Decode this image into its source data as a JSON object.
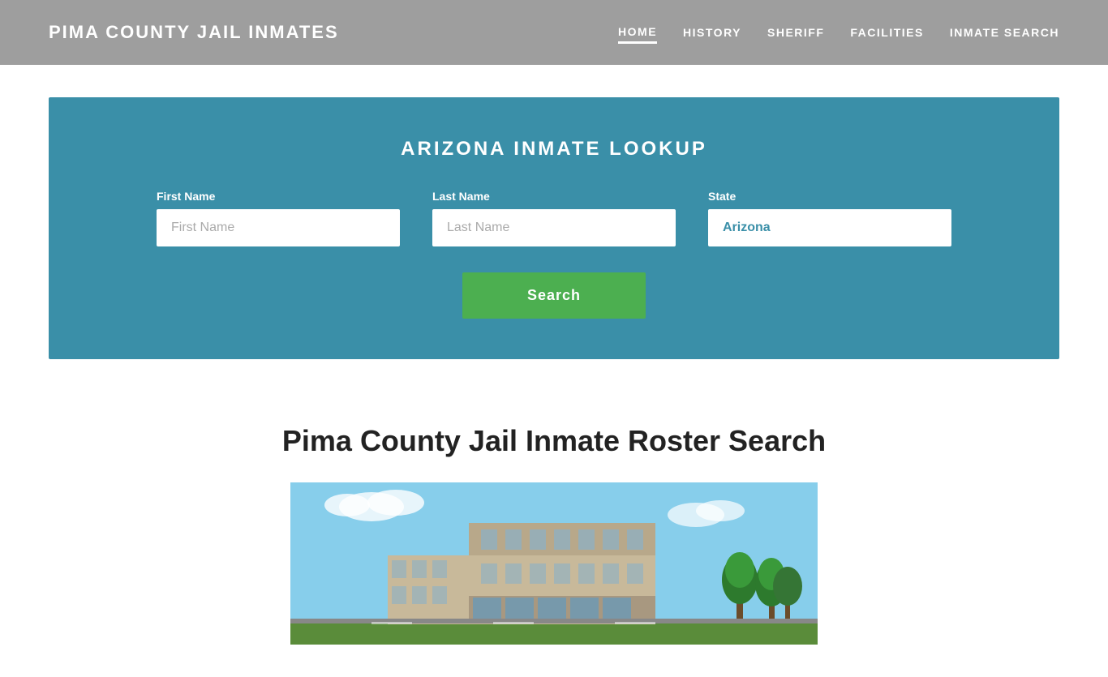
{
  "header": {
    "site_title": "PIMA COUNTY JAIL INMATES",
    "nav_items": [
      {
        "label": "HOME",
        "active": true
      },
      {
        "label": "HISTORY",
        "active": false
      },
      {
        "label": "SHERIFF",
        "active": false
      },
      {
        "label": "FACILITIES",
        "active": false
      },
      {
        "label": "INMATE SEARCH",
        "active": false
      }
    ]
  },
  "search_section": {
    "title": "ARIZONA INMATE LOOKUP",
    "fields": {
      "first_name": {
        "label": "First Name",
        "placeholder": "First Name"
      },
      "last_name": {
        "label": "Last Name",
        "placeholder": "Last Name"
      },
      "state": {
        "label": "State",
        "value": "Arizona"
      }
    },
    "search_button": "Search"
  },
  "main": {
    "heading": "Pima County Jail Inmate Roster Search"
  },
  "colors": {
    "header_bg": "#9e9e9e",
    "search_bg": "#3a8fa8",
    "search_button": "#4caf50",
    "text_white": "#ffffff",
    "heading_dark": "#222222"
  }
}
